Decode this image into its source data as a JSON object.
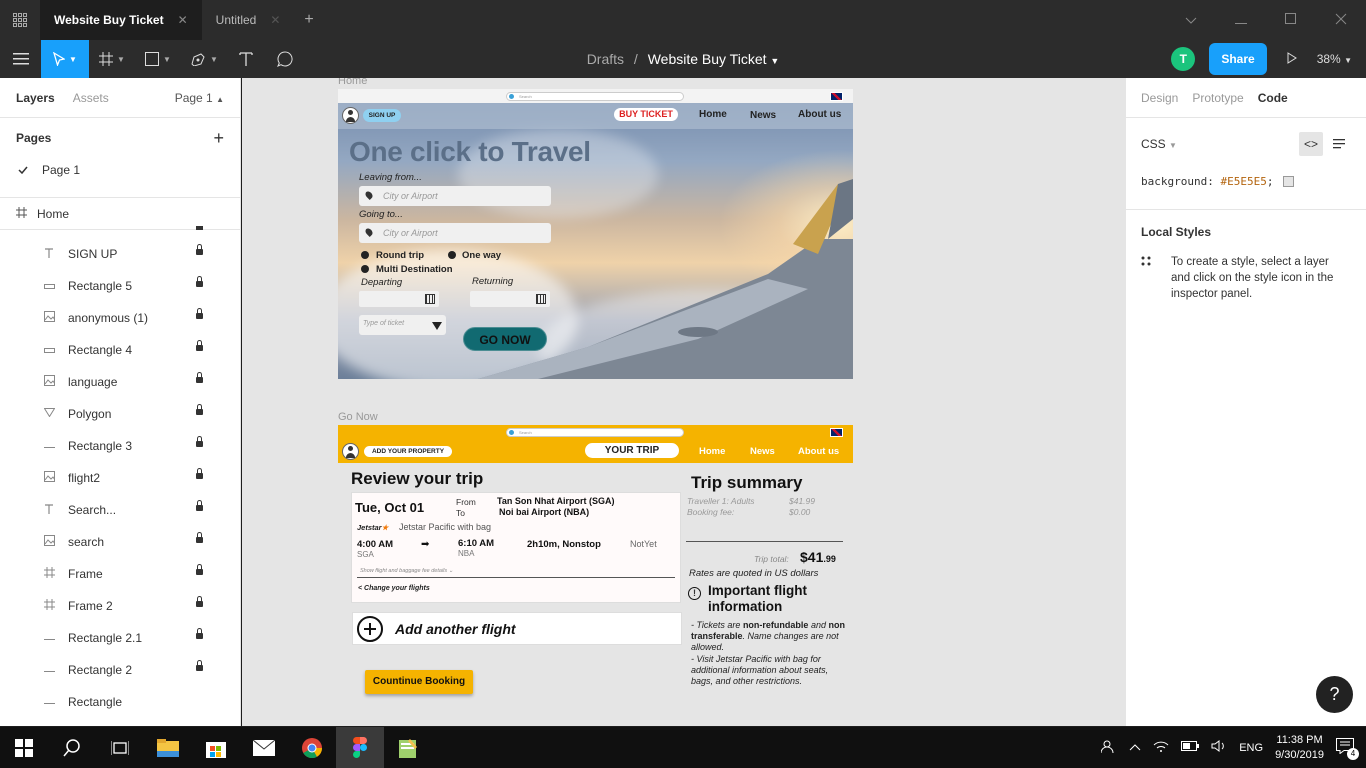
{
  "tabs": [
    {
      "label": "Website Buy Ticket",
      "active": true
    },
    {
      "label": "Untitled",
      "active": false
    }
  ],
  "close_glyph": "✕",
  "plus_glyph": "+",
  "breadcrumb": {
    "parent": "Drafts",
    "separator": "/",
    "file": "Website Buy Ticket"
  },
  "user_initial": "T",
  "share_label": "Share",
  "zoom": "38%",
  "left_panel": {
    "tab_layers": "Layers",
    "tab_assets": "Assets",
    "page_selector": "Page 1",
    "pages_title": "Pages",
    "pages": [
      "Page 1"
    ],
    "frame_name": "Home",
    "layers": [
      {
        "name": "SIGN UP",
        "icon": "text-icon"
      },
      {
        "name": "Rectangle 5",
        "icon": "rectangle-icon"
      },
      {
        "name": "anonymous (1)",
        "icon": "image-icon"
      },
      {
        "name": "Rectangle 4",
        "icon": "rectangle-icon"
      },
      {
        "name": "language",
        "icon": "image-icon"
      },
      {
        "name": "Polygon",
        "icon": "polygon-icon"
      },
      {
        "name": "Rectangle 3",
        "icon": "line-icon"
      },
      {
        "name": "flight2",
        "icon": "image-icon"
      },
      {
        "name": "Search...",
        "icon": "text-icon"
      },
      {
        "name": "search",
        "icon": "image-icon"
      },
      {
        "name": "Frame",
        "icon": "frame-icon"
      },
      {
        "name": "Frame 2",
        "icon": "frame-icon"
      },
      {
        "name": "Rectangle 2.1",
        "icon": "line-icon"
      },
      {
        "name": "Rectangle 2",
        "icon": "line-icon"
      },
      {
        "name": "Rectangle",
        "icon": "line-icon"
      }
    ]
  },
  "right_panel": {
    "tab_design": "Design",
    "tab_prototype": "Prototype",
    "tab_code": "Code",
    "lang": "CSS",
    "code_prop": "background:",
    "code_val": "#E5E5E5",
    "code_end": ";",
    "local_styles_title": "Local Styles",
    "local_styles_hint": "To create a style, select a layer and click on the style icon in the inspector panel."
  },
  "canvas": {
    "bg": "#E5E5E5",
    "home": {
      "label": "Home",
      "search_placeholder": "Search",
      "signup": "SIGN UP",
      "buy_ticket": "BUY TICKET",
      "nav": [
        "Home",
        "News",
        "About us"
      ],
      "hero": "One click to Travel",
      "leaving": "Leaving from...",
      "going": "Going to...",
      "city_placeholder": "City or Airport",
      "round_trip": "Round trip",
      "one_way": "One way",
      "multi": "Multi Destination",
      "departing": "Departing",
      "returning": "Returning",
      "ticket_type": "Type of ticket",
      "go_now": "GO NOW"
    },
    "go": {
      "label": "Go Now",
      "search_placeholder": "Search",
      "add_property": "ADD YOUR PROPERTY",
      "your_trip": "YOUR TRIP",
      "nav": [
        "Home",
        "News",
        "About us"
      ],
      "review": "Review your trip",
      "date": "Tue, Oct 01",
      "from": "From",
      "to": "To",
      "from_airport": "Tan Son Nhat Airport (SGA)",
      "to_airport": "Noi bai Airport (NBA)",
      "airline_logo": "Jetstar",
      "airline": "Jetstar Pacific with bag",
      "dep_time": "4:00 AM",
      "dep_code": "SGA",
      "arr_time": "6:10 AM",
      "arr_code": "NBA",
      "duration": "2h10m, Nonstop",
      "status": "NotYet",
      "details": "Show flight and baggage fee details",
      "change": "Change your flights",
      "add_flight": "Add another flight",
      "continue": "Countinue Booking",
      "summary_title": "Trip summary",
      "traveler": "Traveller 1: Adults",
      "traveler_amt": "$41.99",
      "fee": "Booking fee:",
      "fee_amt": "$0.00",
      "total_label": "Trip total:",
      "total_main": "$41",
      "total_cents": ".99",
      "rates": "Rates are quoted in US dollars",
      "important": "Important flight information",
      "info1_a": " - Tickets are ",
      "info1_b": "non-refundable",
      "info1_c": " and ",
      "info1_d": "non transferable",
      "info1_e": ". Name changes are not allowed.",
      "info2": " - Visit Jetstar Pacific with bag for additional information about seats, bags, and other restrictions."
    }
  },
  "taskbar": {
    "lang": "ENG",
    "time": "11:38 PM",
    "date": "9/30/2019",
    "notif": "4"
  },
  "help": "?"
}
